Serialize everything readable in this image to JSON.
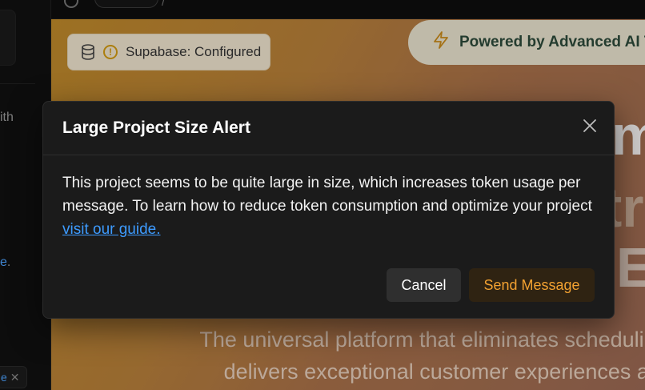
{
  "left_panel": {
    "fragment_1": "ith",
    "fragment_2_link": "e",
    "fragment_2_end": ".",
    "chip_text": "e",
    "chip_close": "✕"
  },
  "topbar": {
    "slash": "/"
  },
  "preview": {
    "supabase_badge": "Supabase: Configured",
    "powered_by": "Powered by Advanced AI Te",
    "big_text_1": "m",
    "big_text_2": "tr",
    "big_text_3": "Ex",
    "subtitle_line_1": "The universal platform that eliminates scheduling",
    "subtitle_line_2": "delivers exceptional customer experiences acro",
    "colors": {
      "badge_warning": "#d29a10",
      "powered_text": "#2c4a3a"
    }
  },
  "modal": {
    "title": "Large Project Size Alert",
    "body_text": "This project seems to be quite large in size, which increases token usage per message. To learn how to reduce token consumption and optimize your project ",
    "link_text": "visit our guide.",
    "cancel_label": "Cancel",
    "send_label": "Send Message",
    "colors": {
      "link": "#3d9bff",
      "send_text": "#f2a131"
    }
  }
}
